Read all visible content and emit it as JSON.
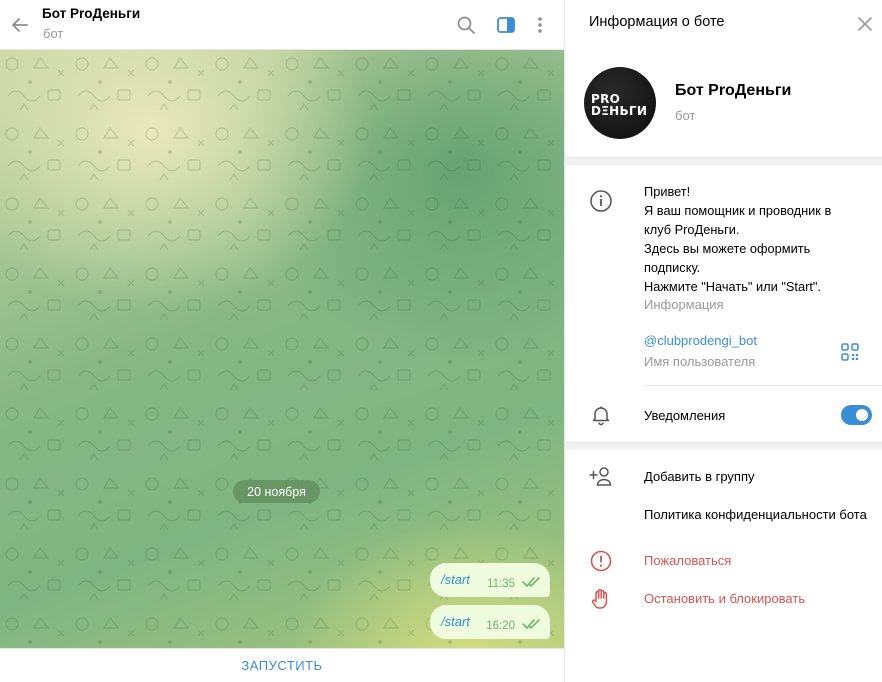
{
  "chat": {
    "title": "Бот ProДеньги",
    "subtitle": "бот",
    "date_badge": "20 ноября",
    "messages": [
      {
        "text": "/start",
        "time": "11:35"
      },
      {
        "text": "/start",
        "time": "16:20"
      }
    ],
    "start_button": "ЗАПУСТИТЬ"
  },
  "panel": {
    "title": "Информация о боте",
    "profile": {
      "name": "Бот ProДеньги",
      "subtitle": "бот",
      "avatar_line1": "PRO",
      "avatar_line2": "DΞНЬГИ"
    },
    "info": {
      "text_lines": [
        "Привет!",
        "Я ваш помощник и проводник в",
        "клуб ProДеньги.",
        "Здесь вы можете оформить",
        "подписку.",
        "Нажмите \"Начать\" или \"Start\"."
      ],
      "label": "Информация"
    },
    "username": {
      "value": "@clubprodengi_bot",
      "label": "Имя пользователя"
    },
    "notifications": {
      "label": "Уведомления",
      "enabled": true
    },
    "actions": {
      "add_to_group": "Добавить в группу",
      "privacy_policy": "Политика конфиденциальности бота",
      "report": "Пожаловаться",
      "stop_block": "Остановить и блокировать"
    }
  },
  "colors": {
    "accent": "#3a8ed6",
    "danger": "#d9534f",
    "bubble": "#effdde",
    "bubble_time": "#6db466"
  },
  "icons": {
    "back": "arrow-left-icon",
    "search": "search-icon",
    "sidebar_toggle": "sidebar-toggle-icon",
    "more": "more-vertical-icon",
    "close": "close-icon",
    "info": "info-icon",
    "qr": "qr-code-icon",
    "bell": "bell-icon",
    "add_user": "add-user-icon",
    "report": "report-icon",
    "stop": "hand-stop-icon",
    "checks": "double-check-icon"
  }
}
